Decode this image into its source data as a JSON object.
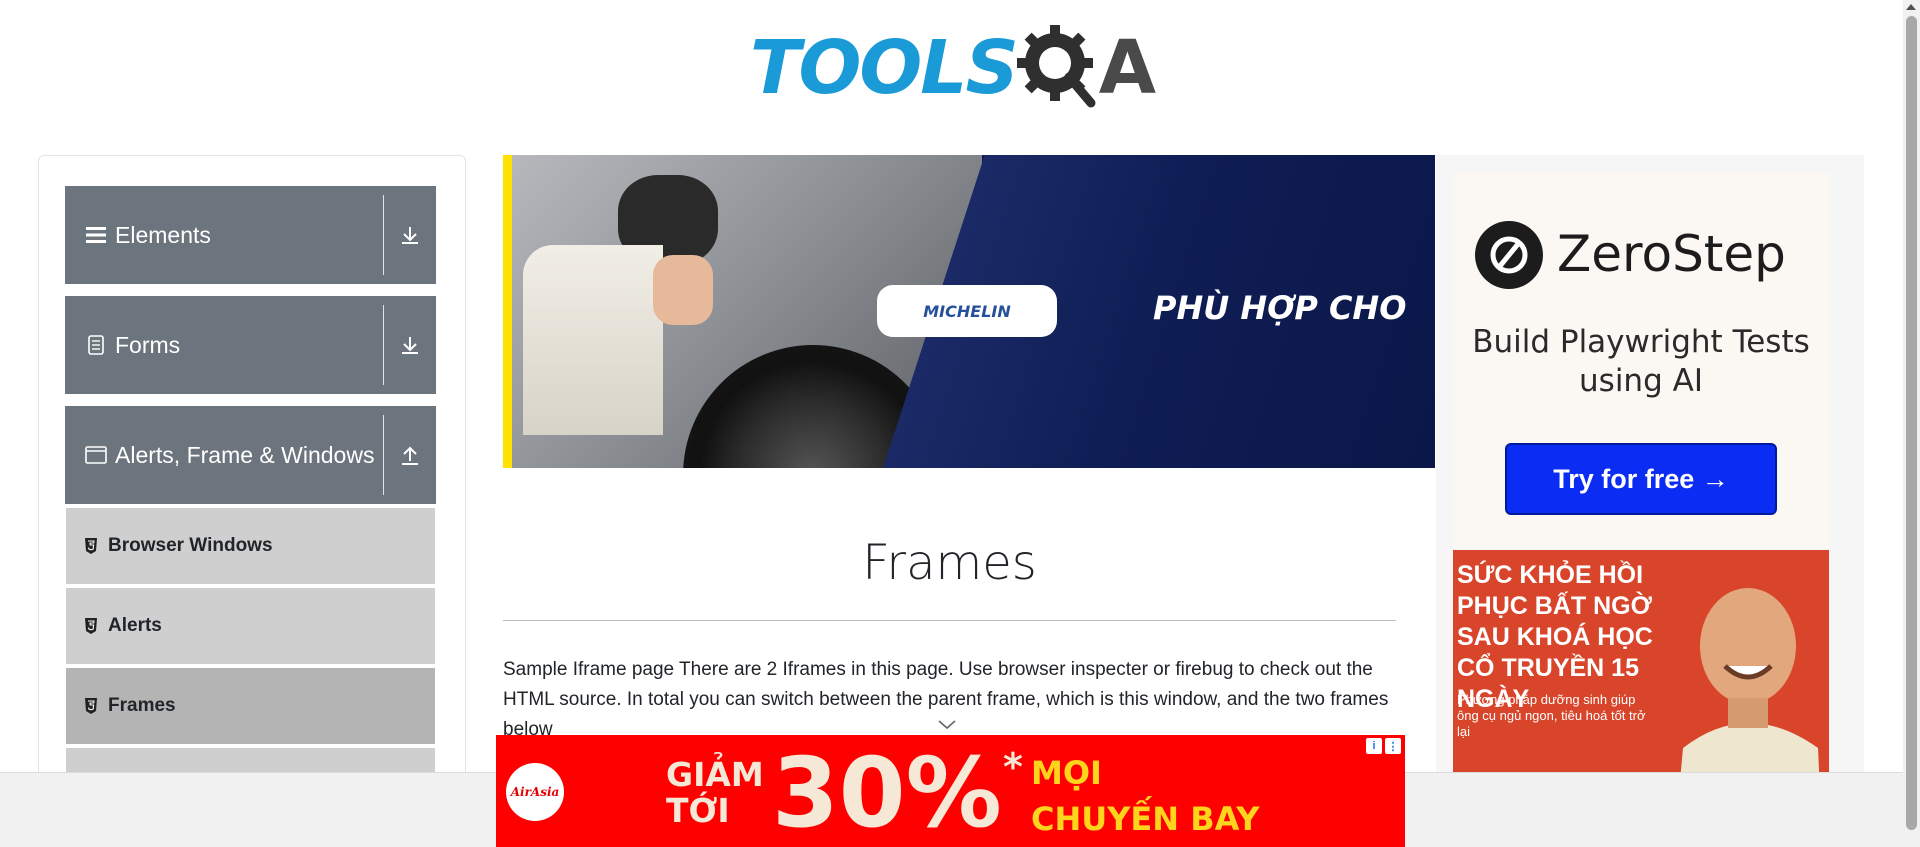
{
  "header": {
    "logo_text": "TOOLS",
    "logo_suffix": "A"
  },
  "sidebar": {
    "groups": [
      {
        "label": "Elements",
        "icon": "list-icon",
        "arrow": "download-arrow-icon"
      },
      {
        "label": "Forms",
        "icon": "document-icon",
        "arrow": "download-arrow-icon"
      },
      {
        "label": "Alerts, Frame & Windows",
        "icon": "window-icon",
        "arrow": "upload-arrow-icon"
      }
    ],
    "items": [
      {
        "label": "Browser Windows",
        "icon": "html5-icon",
        "active": false
      },
      {
        "label": "Alerts",
        "icon": "html5-icon",
        "active": false
      },
      {
        "label": "Frames",
        "icon": "html5-icon",
        "active": true
      }
    ]
  },
  "banner_ad": {
    "brand": "MICHELIN",
    "slogan": "PHÙ HỢP CHO"
  },
  "main": {
    "title": "Frames",
    "description": "Sample Iframe page There are 2 Iframes in this page. Use browser inspecter or firebug to check out the HTML source. In total you can switch between the parent frame, which is this window, and the two frames below"
  },
  "right_ad": {
    "brand": "ZeroStep",
    "tagline": "Build Playwright Tests using AI",
    "cta": "Try for free →"
  },
  "health_ad": {
    "headline": "SỨC KHỎE HỒI PHỤC BẤT NGỜ SAU KHOÁ HỌC CỔ TRUYỀN 15 NGÀY",
    "subtext": "Phương pháp dưỡng sinh giúp ông cụ ngủ ngon, tiêu hoá tốt trở lại"
  },
  "bottom_ad": {
    "brand": "AirAsia",
    "left_text_1": "GIẢM",
    "left_text_2": "TỚI",
    "percent": "30%",
    "star": "*",
    "right_text_1": "MỌI",
    "right_text_2": "CHUYẾN BAY"
  },
  "colors": {
    "logo_blue": "#1a9bd7",
    "sidebar_group": "#6c757d",
    "sidebar_item": "#cfcfcf",
    "sidebar_item_active": "#b4b4b4",
    "zerostep_button": "#0b2cf2",
    "airasia_red": "#ff0000"
  }
}
